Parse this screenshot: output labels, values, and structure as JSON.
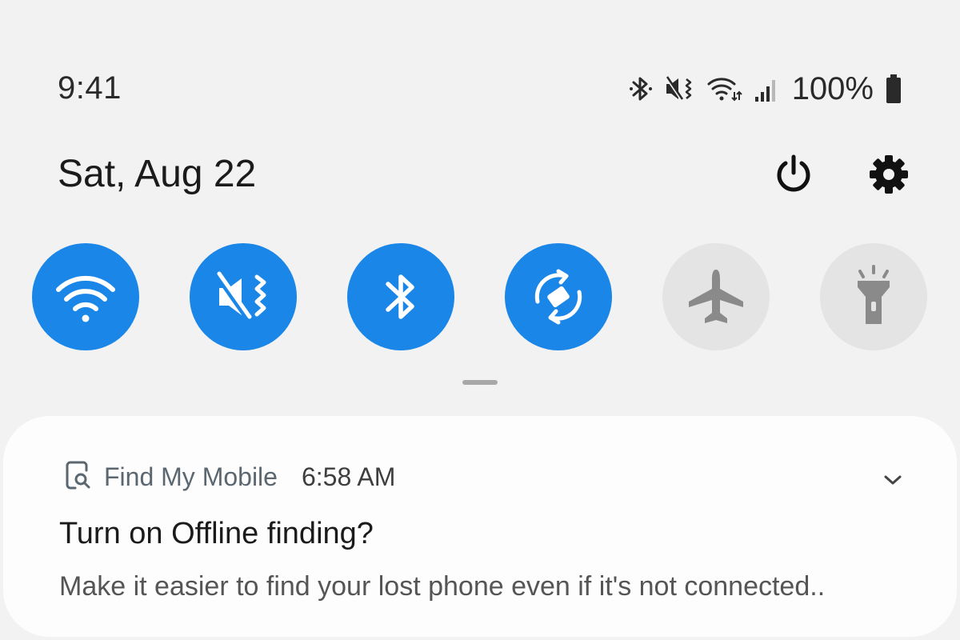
{
  "status_bar": {
    "time": "9:41",
    "battery": "100%",
    "icons": [
      "bluetooth-icon",
      "mute-vibrate-icon",
      "wifi-data-icon",
      "signal-icon",
      "battery-icon"
    ]
  },
  "header": {
    "date": "Sat, Aug 22",
    "actions": [
      "power-icon",
      "gear-icon"
    ]
  },
  "quick_settings": {
    "accent": "#1a86e8",
    "tiles": [
      {
        "icon": "wifi-icon",
        "state": "on"
      },
      {
        "icon": "mute-vibrate-icon",
        "state": "on"
      },
      {
        "icon": "bluetooth-icon",
        "state": "on"
      },
      {
        "icon": "auto-rotate-icon",
        "state": "on"
      },
      {
        "icon": "airplane-icon",
        "state": "off"
      },
      {
        "icon": "flashlight-icon",
        "state": "off"
      }
    ]
  },
  "notification": {
    "app_name": "Find My Mobile",
    "time": "6:58 AM",
    "title": "Turn on Offline finding?",
    "body": "Make it easier to find your lost phone even if it's not connected.."
  }
}
